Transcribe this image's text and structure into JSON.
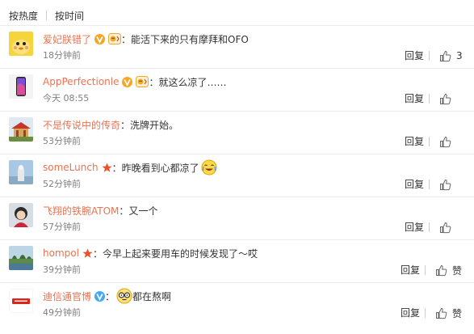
{
  "sort": {
    "hot_label": "按热度",
    "time_label": "按时间"
  },
  "reply_label": "回复",
  "colors": {
    "username": "#eb7350",
    "vip": "#f5a623",
    "verified": "#3fa9f5",
    "star": "#e8512b"
  },
  "comments": [
    {
      "username": "爱妃朕错了",
      "badges": [
        "vip-v",
        "emoji-badge"
      ],
      "text": "能活下来的只有摩拜和OFO",
      "time": "18分钟前",
      "like_text": "3"
    },
    {
      "username": "AppPerfectionle",
      "badges": [
        "vip-v",
        "emoji-badge"
      ],
      "text": "就这么凉了……",
      "time": "今天 08:55",
      "like_text": ""
    },
    {
      "username": "不是传说中的传奇",
      "badges": [],
      "text": "洗牌开始。",
      "time": "53分钟前",
      "like_text": ""
    },
    {
      "username": "someLunch",
      "badges": [
        "star"
      ],
      "text": "昨晚看到心都凉了",
      "emoji": "crying-laugh-emoji",
      "time": "52分钟前",
      "like_text": ""
    },
    {
      "username": "飞翔的铁腕ATOM",
      "badges": [],
      "text": "又一个",
      "time": "57分钟前",
      "like_text": ""
    },
    {
      "username": "hompol",
      "badges": [
        "star"
      ],
      "text": "今早上起来要用车的时候发现了～哎",
      "time": "39分钟前",
      "like_text": "赞"
    },
    {
      "username": "迪信通官博",
      "badges": [
        "verified-v"
      ],
      "text": "都在熬啊",
      "emoji": "glasses-emoji",
      "time": "49分钟前",
      "like_text": "赞"
    }
  ]
}
